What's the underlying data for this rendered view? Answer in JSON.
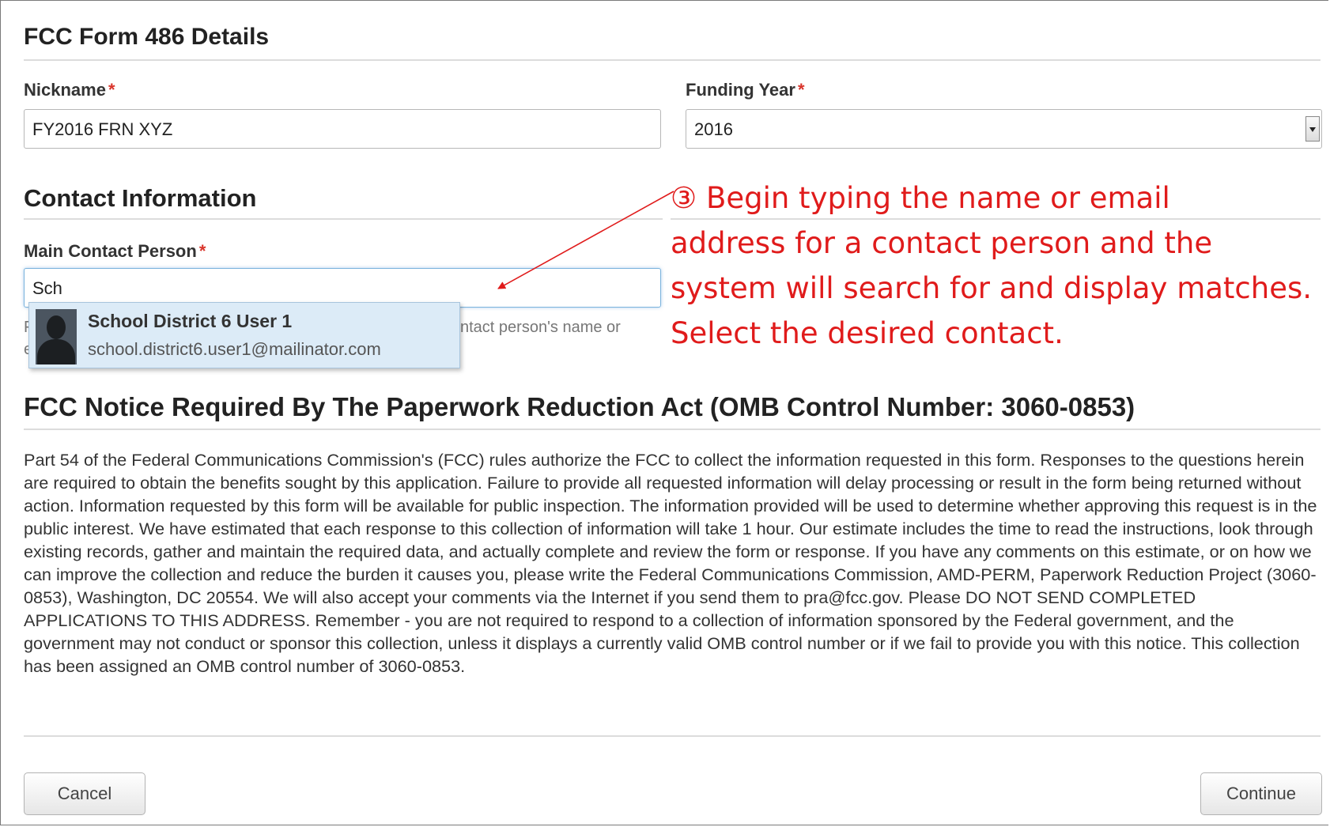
{
  "form": {
    "title": "FCC Form 486 Details",
    "nickname_label": "Nickname",
    "nickname_value": "FY2016 FRN XYZ",
    "funding_year_label": "Funding Year",
    "funding_year_value": "2016",
    "required_marker": "*"
  },
  "contact": {
    "section_title": "Contact Information",
    "main_contact_label": "Main Contact Person",
    "main_contact_value": "Sch",
    "hint_left": "F",
    "hint_left2": "e",
    "hint_right": "ntact person's name or",
    "suggestion": {
      "name": "School District 6 User 1",
      "email": "school.district6.user1@mailinator.com"
    }
  },
  "annotation": {
    "step": "③",
    "lines": [
      "Begin typing the name or email",
      "address for a contact person and the",
      "system will search for and display matches.",
      "Select the desired contact."
    ],
    "color": "#e01b1b"
  },
  "notice": {
    "title": "FCC Notice Required By The Paperwork Reduction Act (OMB Control Number: 3060-0853)",
    "body": "Part 54 of the Federal Communications Commission's (FCC) rules authorize the FCC to collect the information requested in this form. Responses to the questions herein are required to obtain the benefits sought by this application. Failure to provide all requested information will delay processing or result in the form being returned without action. Information requested by this form will be available for public inspection. The information provided will be used to determine whether approving this request is in the public interest. We have estimated that each response to this collection of information will take 1 hour. Our estimate includes the time to read the instructions, look through existing records, gather and maintain the required data, and actually complete and review the form or response. If you have any comments on this estimate, or on how we can improve the collection and reduce the burden it causes you, please write the Federal Communications Commission, AMD-PERM, Paperwork Reduction Project (3060-0853), Washington, DC 20554. We will also accept your comments via the Internet if you send them to pra@fcc.gov. Please DO NOT SEND COMPLETED APPLICATIONS TO THIS ADDRESS. Remember - you are not required to respond to a collection of information sponsored by the Federal government, and the government may not conduct or sponsor this collection, unless it displays a currently valid OMB control number or if we fail to provide you with this notice. This collection has been assigned an OMB control number of 3060-0853."
  },
  "buttons": {
    "cancel": "Cancel",
    "continue": "Continue"
  }
}
